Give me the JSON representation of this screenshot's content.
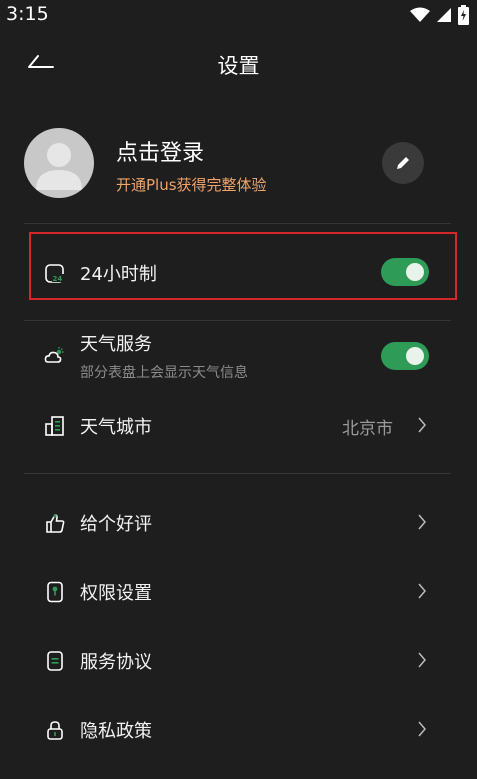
{
  "status_bar": {
    "time": "3:15"
  },
  "header": {
    "title": "设置"
  },
  "profile": {
    "login_label": "点击登录",
    "plus_promo": "开通Plus获得完整体验"
  },
  "settings": {
    "hour24": {
      "label": "24小时制",
      "enabled": true
    },
    "weather_service": {
      "label": "天气服务",
      "description": "部分表盘上会显示天气信息",
      "enabled": true
    },
    "weather_city": {
      "label": "天气城市",
      "value": "北京市"
    }
  },
  "menu": {
    "rate": {
      "label": "给个好评"
    },
    "permissions": {
      "label": "权限设置"
    },
    "service_agreement": {
      "label": "服务协议"
    },
    "privacy_policy": {
      "label": "隐私政策"
    }
  },
  "colors": {
    "accent": "#2e9b56",
    "promo": "#f0a36a",
    "highlight": "#d6282a",
    "background": "#1e1e1e"
  }
}
